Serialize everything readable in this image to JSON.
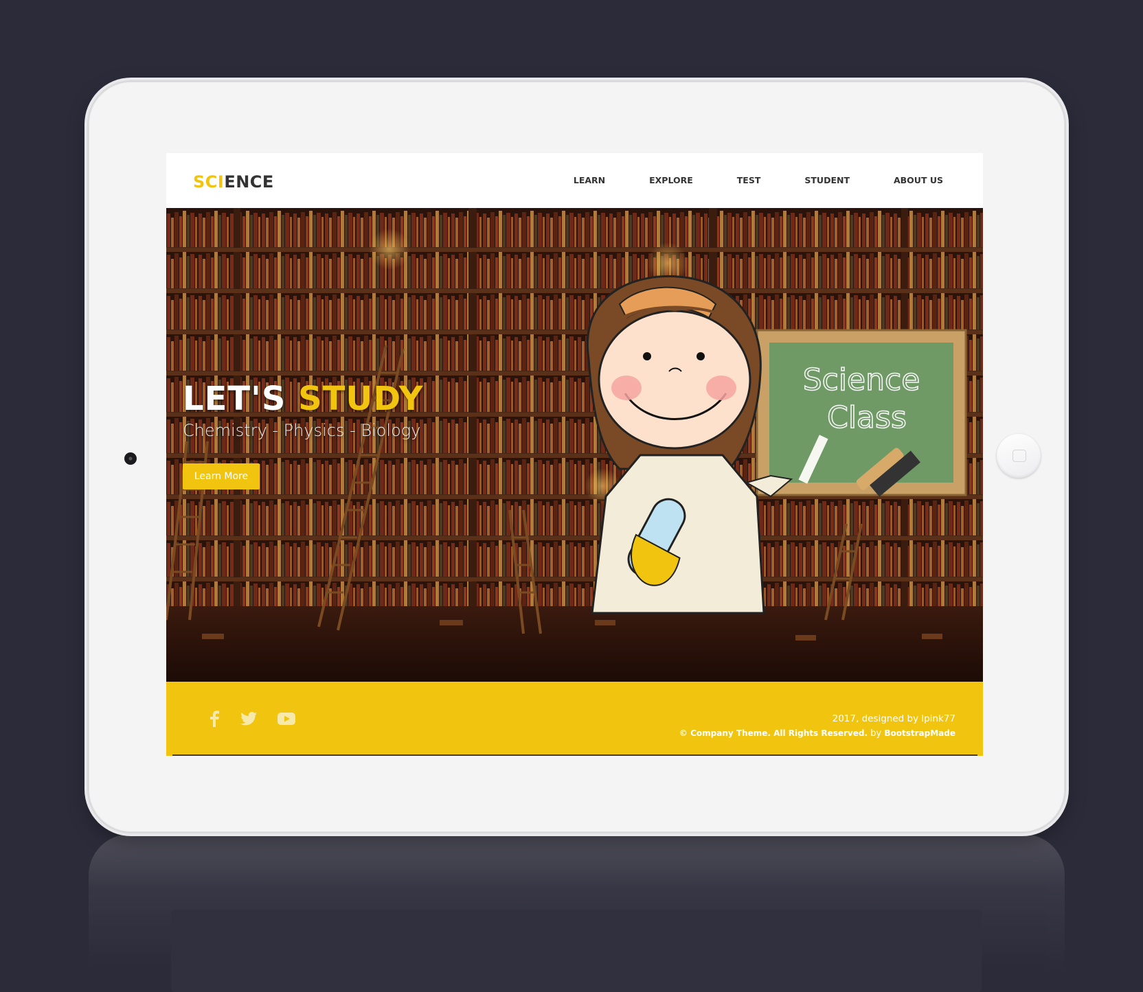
{
  "brand": {
    "part1": "SCI",
    "part2": "ENCE"
  },
  "nav": [
    {
      "label": "LEARN"
    },
    {
      "label": "EXPLORE"
    },
    {
      "label": "TEST"
    },
    {
      "label": "STUDENT"
    },
    {
      "label": "ABOUT US"
    }
  ],
  "hero": {
    "title_part1": "LET'S ",
    "title_part2": "STUDY",
    "subtitle": "Chemistry - Physics - Biology",
    "button_label": "Learn More",
    "board_line1": "Science",
    "board_line2": "Class"
  },
  "footer": {
    "line1": "2017, designed by lpink77",
    "line2": "© Company Theme. All Rights Reserved.",
    "by_label": "by",
    "by_name": "BootstrapMade",
    "social": [
      "facebook-icon",
      "twitter-icon",
      "youtube-icon"
    ]
  },
  "colors": {
    "accent": "#f1c40f",
    "page_bg": "#2c2b3a",
    "text_dark": "#333333"
  }
}
